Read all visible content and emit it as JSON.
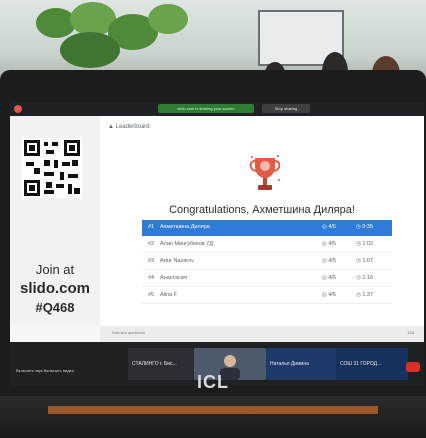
{
  "screen": {
    "tab_label": "Leaderboard",
    "share_notice": "slido.com is sharing your screen",
    "stop_button": "Stop sharing"
  },
  "sidebar": {
    "join_label": "Join at",
    "site": "slido.com",
    "code": "#Q468"
  },
  "main": {
    "congrats": "Congratulations, Ахметшина Диляра!",
    "leaderboard": [
      {
        "rank": "#1",
        "name": "Ахметшина Диляра",
        "score": "4/5",
        "time": "0:35"
      },
      {
        "rank": "#2",
        "name": "Алан Мингубеков 7Д",
        "score": "4/5",
        "time": "1:02"
      },
      {
        "rank": "#3",
        "name": "Artur Nazarov",
        "score": "4/5",
        "time": "1:07"
      },
      {
        "rank": "#4",
        "name": "Анастасия",
        "score": "4/5",
        "time": "1:16"
      },
      {
        "rank": "#5",
        "name": "Alina F",
        "score": "4/5",
        "time": "1:37"
      }
    ]
  },
  "footer": {
    "question_label": "Nahdzul questions",
    "count": "103"
  },
  "taskbar": {
    "left_text": "Включить звук   Включить видео",
    "tiles": [
      {
        "label": "СТАЛИНГО г. Бис..."
      },
      {
        "label": ""
      },
      {
        "label": "Наталья Димина"
      },
      {
        "label": "СОШ 31 ГОРОД..."
      }
    ]
  },
  "laptop": {
    "brand": "ICL"
  },
  "colors": {
    "highlight": "#2f7bd8",
    "trophy": "#e25b45",
    "share_green": "#2e7d32",
    "end_call": "#d93025"
  }
}
